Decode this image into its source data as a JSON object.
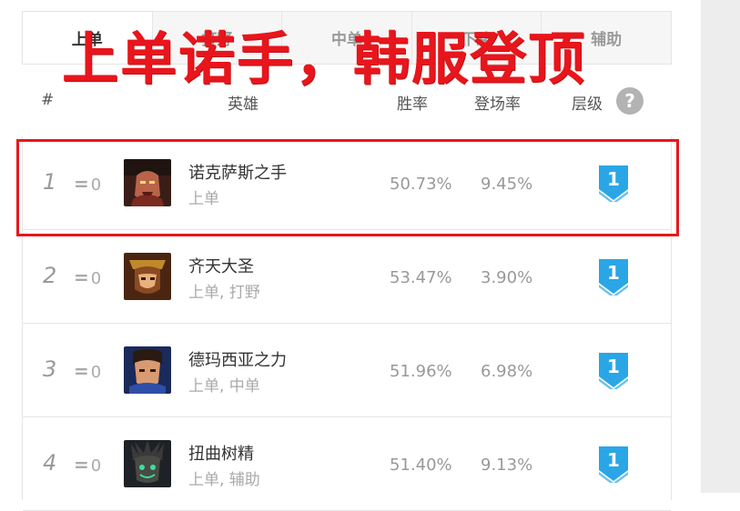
{
  "headline": "上单诺手，韩服登顶",
  "tabs": [
    {
      "label": "上单",
      "active": true
    },
    {
      "label": "打野",
      "active": false
    },
    {
      "label": "中单",
      "active": false
    },
    {
      "label": "下路",
      "active": false
    },
    {
      "label": "辅助",
      "active": false
    }
  ],
  "columns": {
    "rank": "#",
    "hero": "英雄",
    "win_rate": "胜率",
    "pick_rate": "登场率",
    "tier": "层级",
    "help": "?"
  },
  "rows": [
    {
      "rank": "1",
      "change_sym": "=",
      "change": "0",
      "name": "诺克萨斯之手",
      "roles": "上单",
      "win_rate": "50.73%",
      "pick_rate": "9.45%",
      "tier": "1"
    },
    {
      "rank": "2",
      "change_sym": "=",
      "change": "0",
      "name": "齐天大圣",
      "roles": "上单, 打野",
      "win_rate": "53.47%",
      "pick_rate": "3.90%",
      "tier": "1"
    },
    {
      "rank": "3",
      "change_sym": "=",
      "change": "0",
      "name": "德玛西亚之力",
      "roles": "上单, 中单",
      "win_rate": "51.96%",
      "pick_rate": "6.98%",
      "tier": "1"
    },
    {
      "rank": "4",
      "change_sym": "=",
      "change": "0",
      "name": "扭曲树精",
      "roles": "上单, 辅助",
      "win_rate": "51.40%",
      "pick_rate": "9.13%",
      "tier": "1"
    }
  ],
  "colors": {
    "accent_red": "#e8161c",
    "tier_badge": "#2aa6e6"
  },
  "icons": {
    "help": "question-circle-icon",
    "tier": "tier-badge-icon",
    "avatar": "champion-portrait-icon"
  }
}
